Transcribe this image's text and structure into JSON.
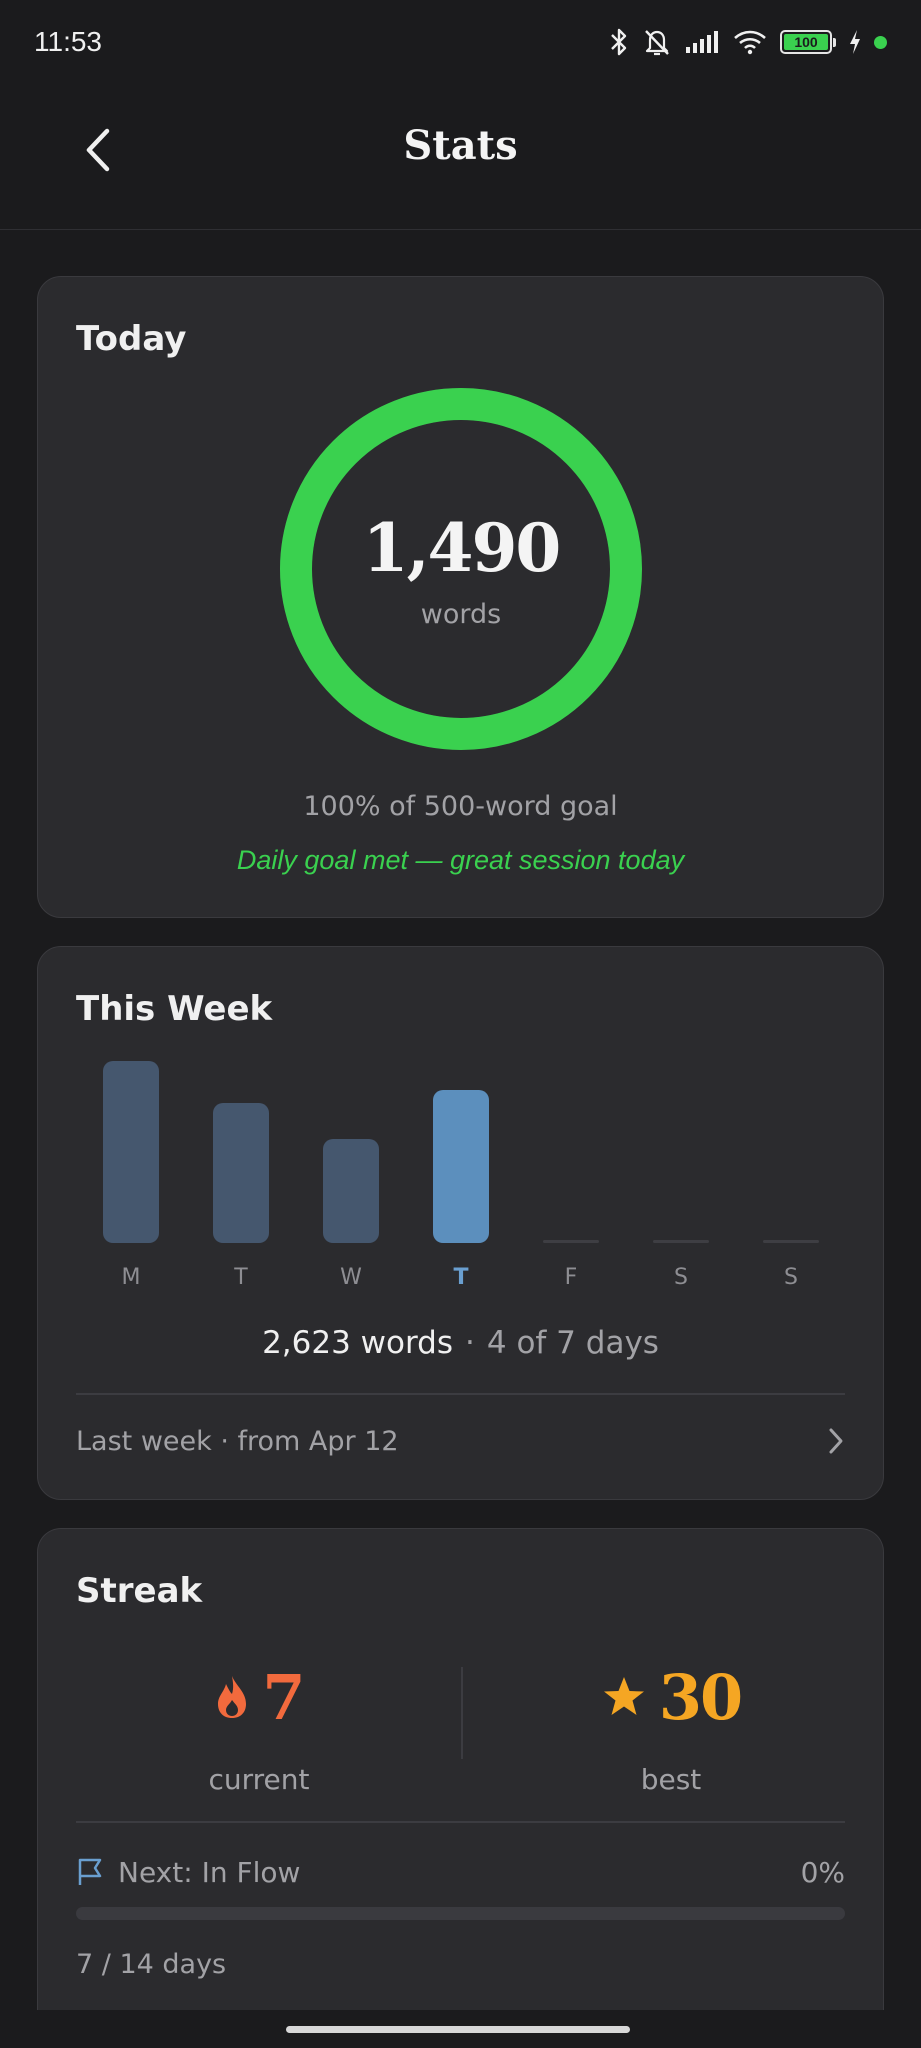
{
  "status_bar": {
    "time": "11:53",
    "battery_level": "100",
    "icons": [
      "bluetooth-icon",
      "bell-muted-icon",
      "signal-icon",
      "wifi-icon",
      "battery-icon",
      "charging-icon",
      "green-dot-indicator"
    ]
  },
  "header": {
    "title": "Stats",
    "back_icon": "chevron-left-icon"
  },
  "today": {
    "title": "Today",
    "word_count": "1,490",
    "unit": "words",
    "goal_text": "100% of 500-word goal",
    "goal_progress": 1.0,
    "message": "Daily goal met — great session today",
    "ring_color": "#3ad14f"
  },
  "week": {
    "title": "This Week",
    "chart_data": {
      "type": "bar",
      "categories": [
        "M",
        "T",
        "W",
        "T",
        "F",
        "S",
        "S"
      ],
      "values": [
        1,
        0.77,
        0.57,
        0.84,
        0,
        0,
        0
      ],
      "highlighted_index": 3
    },
    "summary_words": "2,623 words",
    "summary_sep": "·",
    "summary_days": "4 of 7 days",
    "last_week_label": "Last week · from Apr 12",
    "bar_color": "#45576e",
    "bar_active_color": "#5c8fbd"
  },
  "streak": {
    "title": "Streak",
    "current_value": "7",
    "current_label": "current",
    "current_icon": "flame-icon",
    "current_color": "#f26a3d",
    "best_value": "30",
    "best_label": "best",
    "best_icon": "star-icon",
    "best_color": "#f5a623",
    "next_icon": "flag-icon",
    "next_label": "Next: In Flow",
    "next_percent": "0%",
    "next_progress": 0,
    "next_days": "7 / 14 days"
  }
}
